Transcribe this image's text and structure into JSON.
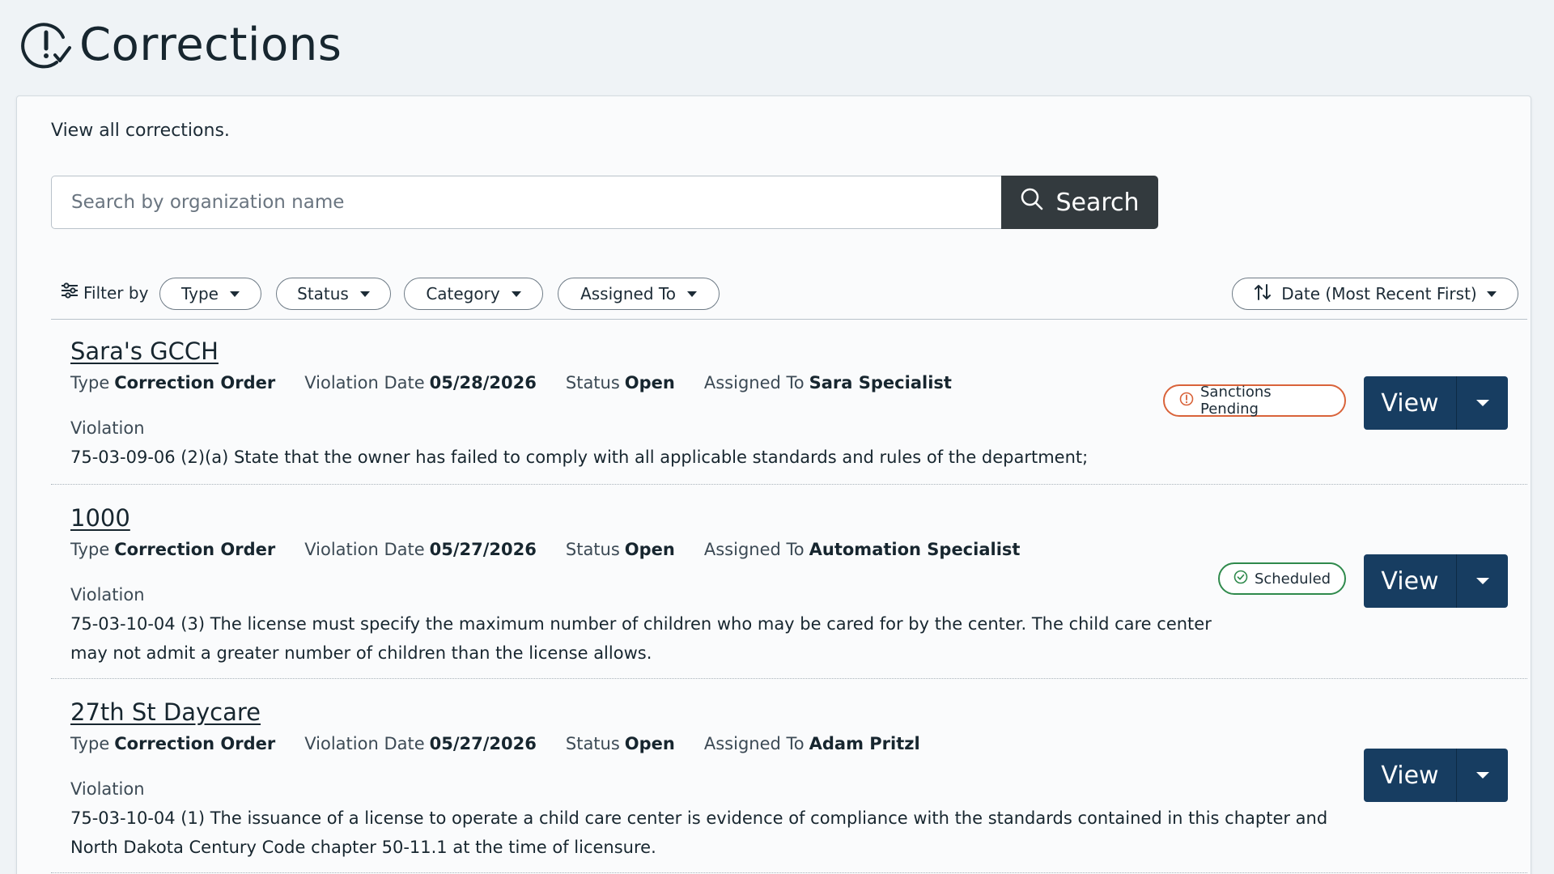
{
  "header": {
    "title": "Corrections",
    "icon": "alert-check-icon"
  },
  "intro": "View all corrections.",
  "search": {
    "placeholder": "Search by organization name",
    "value": "",
    "button_label": "Search"
  },
  "filters": {
    "label": "Filter by",
    "items": [
      "Type",
      "Status",
      "Category",
      "Assigned To"
    ],
    "sort_label": "Date (Most Recent First)"
  },
  "labels": {
    "type": "Type",
    "violation_date": "Violation Date",
    "status": "Status",
    "assigned_to": "Assigned To",
    "violation": "Violation",
    "view": "View"
  },
  "corrections": [
    {
      "name": "Sara's GCCH",
      "type": "Correction Order",
      "violation_date": "05/28/2026",
      "status": "Open",
      "assigned_to": "Sara Specialist",
      "violation": "75-03-09-06 (2)(a) State that the owner has failed to comply with all applicable standards and rules of the department;",
      "badge": {
        "label": "Sanctions Pending",
        "color": "#d9633a"
      }
    },
    {
      "name": "1000",
      "type": "Correction Order",
      "violation_date": "05/27/2026",
      "status": "Open",
      "assigned_to": "Automation Specialist",
      "violation": "75-03-10-04 (3) The license must specify the maximum number of children who may be cared for by the center. The child care center may not admit a greater number of children than the license allows.",
      "badge": {
        "label": "Scheduled",
        "color": "#2f8a4c"
      }
    },
    {
      "name": "27th St Daycare",
      "type": "Correction Order",
      "violation_date": "05/27/2026",
      "status": "Open",
      "assigned_to": "Adam Pritzl",
      "violation": "75-03-10-04 (1) The issuance of a license to operate a child care center is evidence of compliance with the standards contained in this chapter and North Dakota Century Code chapter 50-11.1 at the time of licensure."
    }
  ]
}
